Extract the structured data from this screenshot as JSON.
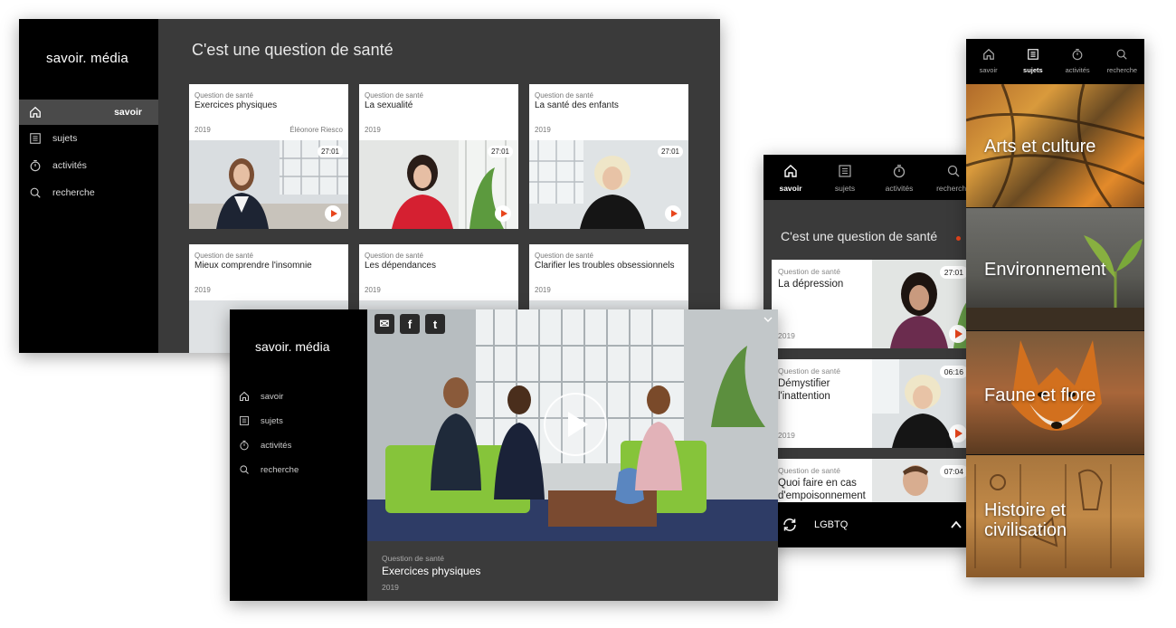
{
  "tv": {
    "logo": "savoir. média",
    "nav": [
      {
        "label": "savoir",
        "icon": "home-icon"
      },
      {
        "label": "sujets",
        "icon": "list-icon"
      },
      {
        "label": "activités",
        "icon": "timer-icon"
      },
      {
        "label": "recherche",
        "icon": "search-icon"
      }
    ],
    "heading": "C'est une question de santé",
    "cards": [
      {
        "kicker": "Question de santé",
        "title": "Exercices physiques",
        "year": "2019",
        "author": "Éléonore Riesco",
        "duration": "27:01"
      },
      {
        "kicker": "Question de santé",
        "title": "La sexualité",
        "year": "2019",
        "author": "",
        "duration": "27:01"
      },
      {
        "kicker": "Question de santé",
        "title": "La santé des enfants",
        "year": "2019",
        "author": "",
        "duration": "27:01"
      },
      {
        "kicker": "Question de santé",
        "title": "Mieux comprendre l'insomnie",
        "year": "2019",
        "author": "",
        "duration": ""
      },
      {
        "kicker": "Question de santé",
        "title": "Les dépendances",
        "year": "2019",
        "author": "",
        "duration": ""
      },
      {
        "kicker": "Question de santé",
        "title": "Clarifier les troubles obsessionnels",
        "year": "2019",
        "author": "",
        "duration": ""
      }
    ]
  },
  "player": {
    "logo": "savoir. média",
    "nav": [
      {
        "label": "savoir",
        "icon": "home-icon"
      },
      {
        "label": "sujets",
        "icon": "list-icon"
      },
      {
        "label": "activités",
        "icon": "timer-icon"
      },
      {
        "label": "recherche",
        "icon": "search-icon"
      }
    ],
    "social": {
      "email": "✉",
      "facebook": "f",
      "twitter": "t"
    },
    "caption": {
      "kicker": "Question de santé",
      "title": "Exercices physiques",
      "year": "2019"
    }
  },
  "mobile": {
    "tabs": [
      {
        "label": "savoir",
        "icon": "home-icon"
      },
      {
        "label": "sujets",
        "icon": "list-icon"
      },
      {
        "label": "activités",
        "icon": "timer-icon"
      },
      {
        "label": "recherche",
        "icon": "search-icon"
      }
    ],
    "heading": "C'est une question de santé",
    "rows": [
      {
        "kicker": "Question de santé",
        "title": "La dépression",
        "year": "2019",
        "duration": "27:01"
      },
      {
        "kicker": "Question de santé",
        "title": "Démystifier l'inattention",
        "year": "2019",
        "duration": "06:16"
      },
      {
        "kicker": "Question de santé",
        "title": "Quoi faire en cas d'empoisonnement",
        "year": "",
        "duration": "07:04"
      }
    ],
    "bottom_label": "LGBTQ"
  },
  "topics": {
    "tabs": [
      {
        "label": "savoir",
        "icon": "home-icon"
      },
      {
        "label": "sujets",
        "icon": "list-icon"
      },
      {
        "label": "activités",
        "icon": "timer-icon"
      },
      {
        "label": "recherche",
        "icon": "search-icon"
      }
    ],
    "tiles": [
      {
        "name": "Arts et culture"
      },
      {
        "name": "Environnement"
      },
      {
        "name": "Faune et flore"
      },
      {
        "name": "Histoire et civilisation"
      }
    ]
  },
  "colors": {
    "accent": "#e8451c",
    "panel": "#3a3a3a",
    "sidebar": "#000000"
  }
}
